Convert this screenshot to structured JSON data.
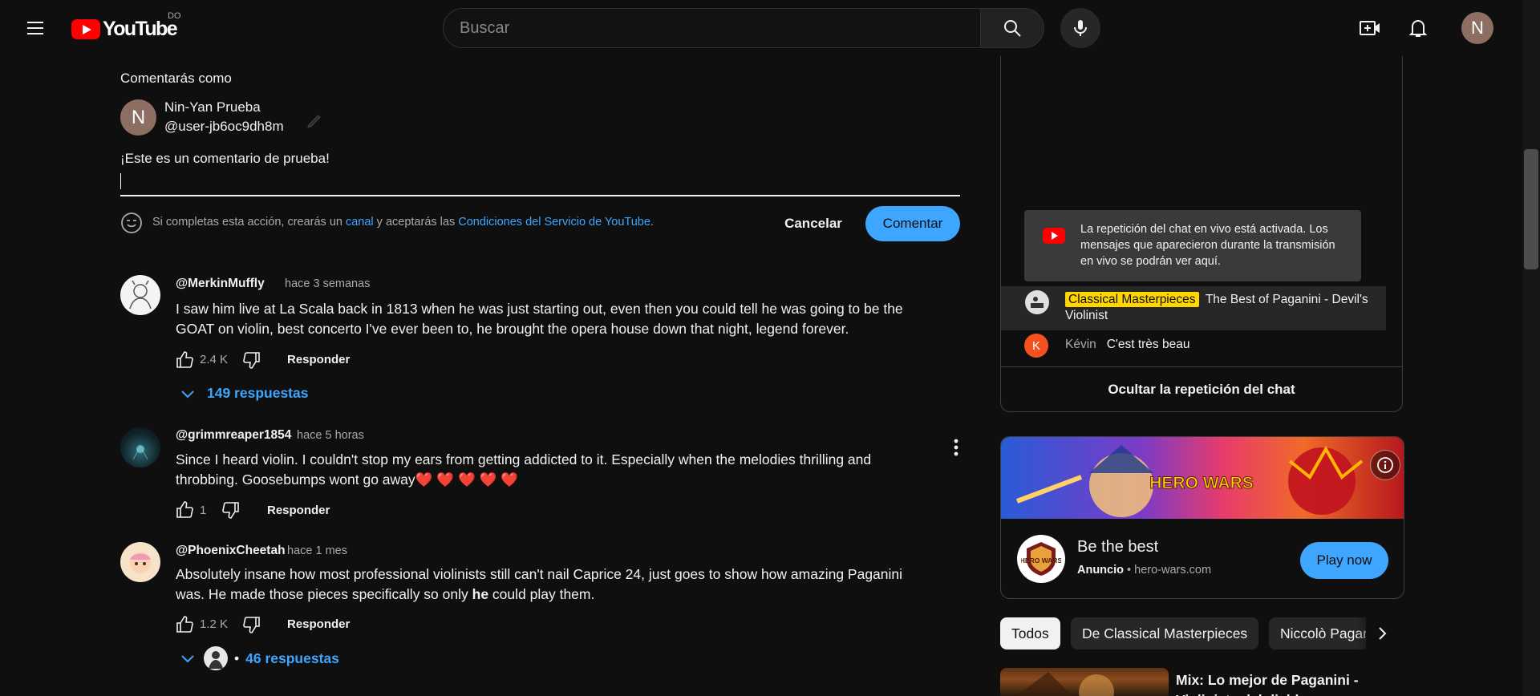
{
  "header": {
    "logo_text": "YouTube",
    "country": "DO",
    "search_placeholder": "Buscar",
    "avatar_letter": "N"
  },
  "composer": {
    "comment_as": "Comentarás como",
    "name": "Nin-Yan Prueba",
    "handle": "@user-jb6oc9dh8m",
    "avatar_letter": "N",
    "draft_text": "¡Este es un comentario de prueba!",
    "terms_prefix": "Si completas esta acción, crearás un ",
    "terms_link1": "canal",
    "terms_middle": " y aceptarás las ",
    "terms_link2": "Condiciones del Servicio de YouTube",
    "terms_suffix": ".",
    "cancel_label": "Cancelar",
    "submit_label": "Comentar"
  },
  "comments": [
    {
      "author": "@MerkinMuffly",
      "time": "hace 3 semanas",
      "text": "I saw him live at La Scala back in 1813 when he was just starting out, even then you could tell he was going to be the GOAT on violin, best concerto I've ever been to, he brought the opera house down that night, legend forever.",
      "likes": "2.4 K",
      "reply_label": "Responder",
      "replies_label": "149 respuestas"
    },
    {
      "author": "@grimmreaper1854",
      "time": "hace 5 horas",
      "text": "Since I heard violin. I couldn't stop my ears from getting addicted to it. Especially when the melodies thrilling and throbbing. Goosebumps wont go away❤️ ❤️ ❤️ ❤️ ❤️",
      "likes": "1",
      "reply_label": "Responder"
    },
    {
      "author": "@PhoenixCheetah",
      "time": "hace 1 mes",
      "text_before": "Absolutely insane how most professional violinists still can't nail Caprice 24, just goes to show how amazing Paganini was. He made those pieces specifically so only ",
      "text_bold": "he",
      "text_after": " could play them.",
      "likes": "1.2 K",
      "reply_label": "Responder",
      "replies_separator": "•",
      "replies_label": "46 respuestas"
    }
  ],
  "chat": {
    "notice": "La repetición del chat en vivo está activada. Los mensajes que aparecieron durante la transmisión en vivo se podrán ver aquí.",
    "messages": [
      {
        "author": "Classical Masterpieces",
        "text": "The Best of Paganini - Devil's Violinist"
      },
      {
        "author": "Kévin",
        "avatar_letter": "K",
        "text": "C'est très beau"
      }
    ],
    "hide_label": "Ocultar la repetición del chat"
  },
  "ad": {
    "title": "Be the best",
    "label": "Anuncio",
    "separator": "•",
    "domain": "hero-wars.com",
    "cta": "Play now",
    "banner_text": "HERO WARS",
    "logo_text": "HERO WARS"
  },
  "chips": [
    "Todos",
    "De Classical Masterpieces",
    "Niccolò Paganini"
  ],
  "recommendation": {
    "title": "Mix: Lo mejor de Paganini - Violinista del diablo"
  },
  "colors": {
    "background": "#0f0f0f",
    "accent": "#3ea6ff",
    "brand_red": "#ff0000",
    "chat_badge": "#ffd600"
  }
}
